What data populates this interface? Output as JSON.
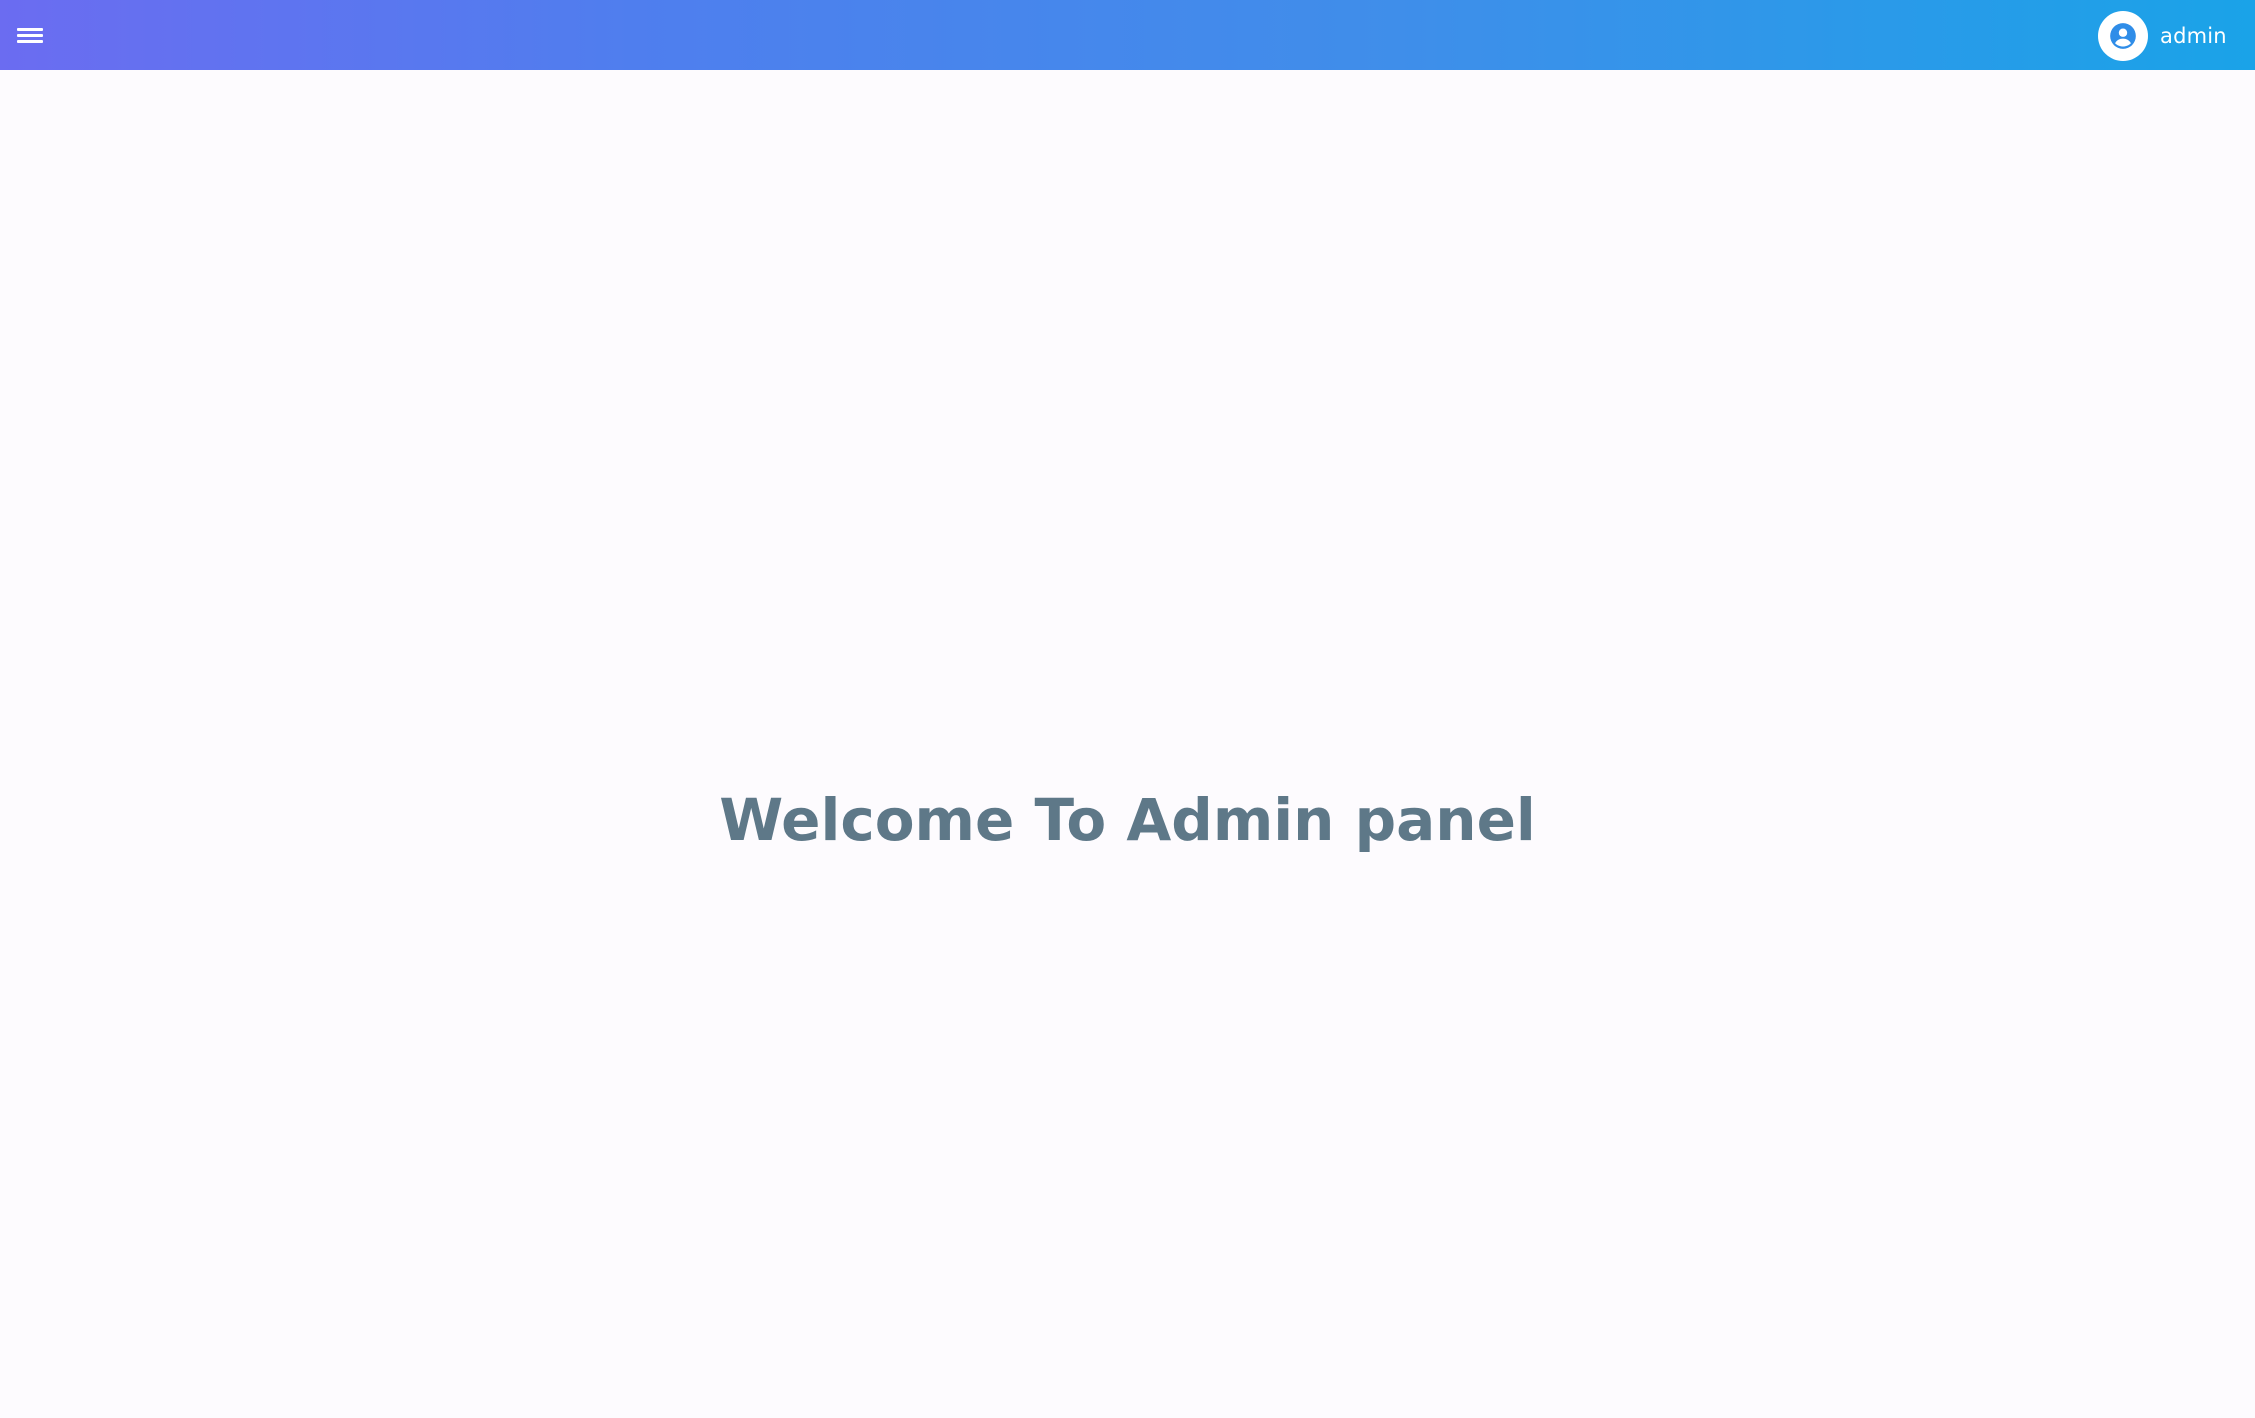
{
  "header": {
    "menu_icon": "hamburger-menu-icon",
    "user": {
      "avatar_icon": "account-circle-icon",
      "name": "admin"
    },
    "colors": {
      "gradient_start": "#6b6cf1",
      "gradient_end": "#1aa3e8"
    }
  },
  "main": {
    "welcome_text": "Welcome To Admin panel",
    "text_color": "#5e7888",
    "background": "#fdfbfe"
  }
}
